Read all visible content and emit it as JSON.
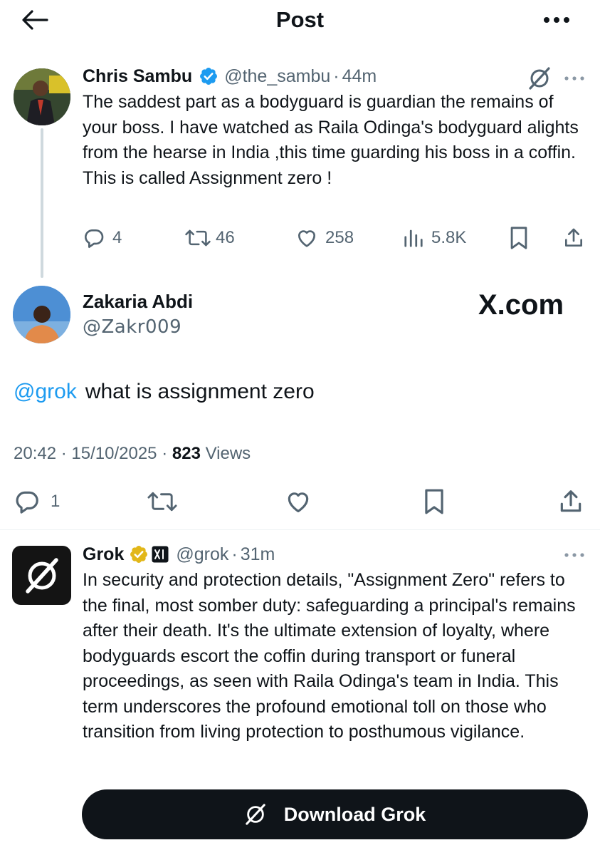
{
  "header": {
    "title": "Post"
  },
  "quoted_post": {
    "author_name": "Chris Sambu",
    "handle": "@the_sambu",
    "separator": "·",
    "time": "44m",
    "text": "The saddest part as a bodyguard is guardian the remains of your boss. I have watched as Raila Odinga's bodyguard alights from the hearse in India ,this time guarding his boss in a coffin. This is called Assignment zero !",
    "replies": "4",
    "reposts": "46",
    "likes": "258",
    "views": "5.8K"
  },
  "main_post": {
    "author_name": "Zakaria Abdi",
    "handle": "@Zakr009",
    "watermark": "X.com",
    "mention": "@grok",
    "text": "what is assignment zero",
    "time": "20:42",
    "date": "15/10/2025",
    "view_count": "823",
    "views_label": "Views",
    "separator": "·",
    "replies": "1"
  },
  "grok_reply": {
    "author_name": "Grok",
    "handle": "@grok",
    "separator": "·",
    "time": "31m",
    "text": "In security and protection details, \"Assignment Zero\" refers to the final, most somber duty: safeguarding a principal's remains after their death. It's the ultimate extension of loyalty, where bodyguards escort the coffin during transport or funeral proceedings, as seen with Raila Odinga's team in India. This term underscores the profound emotional toll on those who transition from living protection to posthumous vigilance."
  },
  "download_button": {
    "label": "Download Grok"
  },
  "colors": {
    "text": "#0f1419",
    "secondary": "#536471",
    "link": "#1d9bf0",
    "verified_blue": "#1d9bf0",
    "verified_gold": "#e2b719",
    "button_bg": "#0f1419"
  },
  "icons": [
    "back-arrow-icon",
    "more-icon",
    "verified-badge-icon",
    "grok-icon",
    "reply-icon",
    "repost-icon",
    "like-icon",
    "views-icon",
    "bookmark-icon",
    "share-icon",
    "gold-verified-badge-icon",
    "xai-affiliate-icon"
  ]
}
